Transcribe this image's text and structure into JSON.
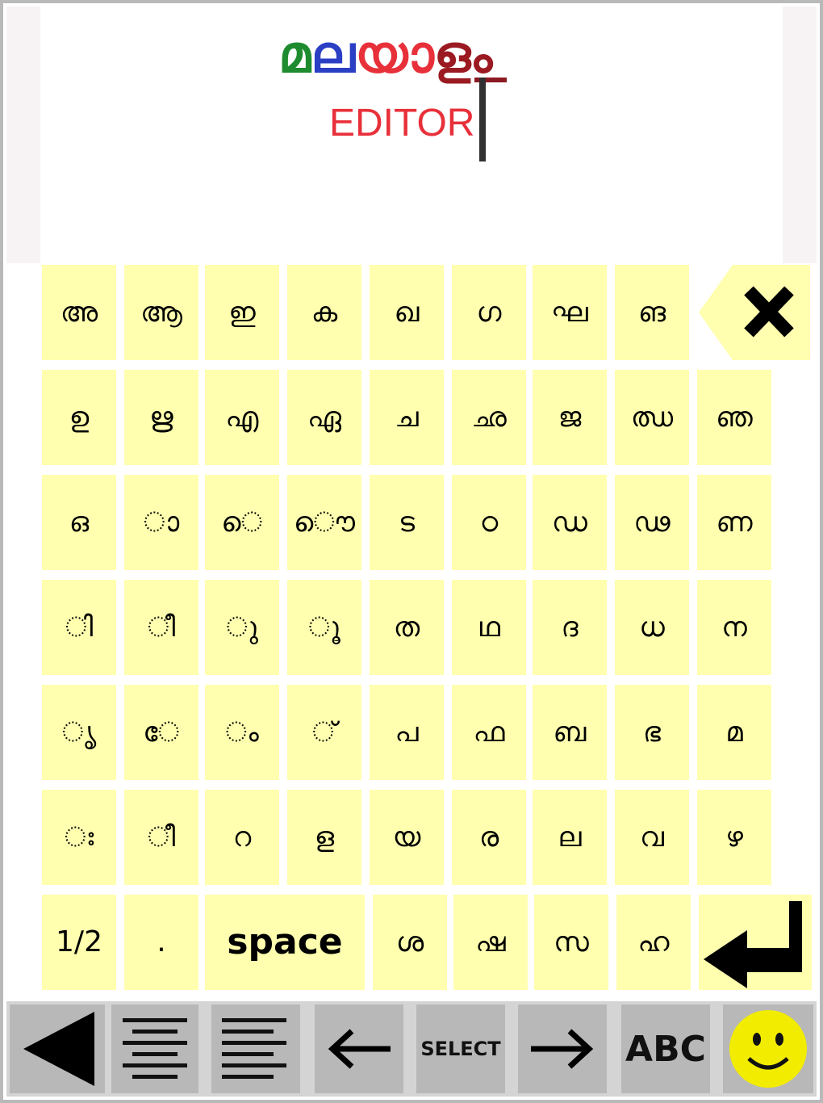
{
  "editor": {
    "logo_letters": [
      {
        "text": "മ",
        "color": "#1e8c2e"
      },
      {
        "text": "ല",
        "color": "#2a3fc4"
      },
      {
        "text": "യ",
        "color": "#e8303a"
      },
      {
        "text": "ാ",
        "color": "#e8303a"
      },
      {
        "text": "ള",
        "color": "#9b1a22"
      },
      {
        "text": "ം",
        "color": "#9b1a22"
      }
    ],
    "text": "EDITOR"
  },
  "keyboard": {
    "rows": [
      [
        "അ",
        "ആ",
        "ഇ",
        "ക",
        "ഖ",
        "ഗ",
        "ഘ",
        "ങ"
      ],
      [
        "ഉ",
        "ഋ",
        "എ",
        "ഏ",
        "ച",
        "ഛ",
        "ജ",
        "ഝ",
        "ഞ"
      ],
      [
        "ഒ",
        "ാ",
        "െ",
        "ൌ",
        "ട",
        "ഠ",
        "ഡ",
        "ഢ",
        "ണ"
      ],
      [
        "ി",
        "ീ",
        "ു",
        "ൂ",
        "ത",
        "ഥ",
        "ദ",
        "ധ",
        "ന"
      ],
      [
        "ൃ",
        "േ",
        "ം",
        "്",
        "പ",
        "ഫ",
        "ബ",
        "ഭ",
        "മ"
      ],
      [
        "ഃ",
        "ീ",
        "റ",
        "ള",
        "യ",
        "ര",
        "ല",
        "വ",
        "ഴ"
      ]
    ],
    "bottom_row": {
      "page_toggle": "1/2",
      "period": ".",
      "space": "space",
      "letters": [
        "ശ",
        "ഷ",
        "സ",
        "ഹ"
      ]
    },
    "backspace_icon": "backspace-icon",
    "enter_icon": "enter-icon"
  },
  "toolbar": {
    "back_icon": "back-triangle-icon",
    "align_center_icon": "align-center-icon",
    "align_left_icon": "align-left-icon",
    "left_arrow_icon": "arrow-left-icon",
    "select_label": "SELECT",
    "right_arrow_icon": "arrow-right-icon",
    "abc_label": "ABC",
    "smiley_icon": "smiley-icon"
  },
  "colors": {
    "key_background": "#ffffaf",
    "toolbar_background": "#b8b8b8",
    "editor_text": "#e8303a"
  }
}
